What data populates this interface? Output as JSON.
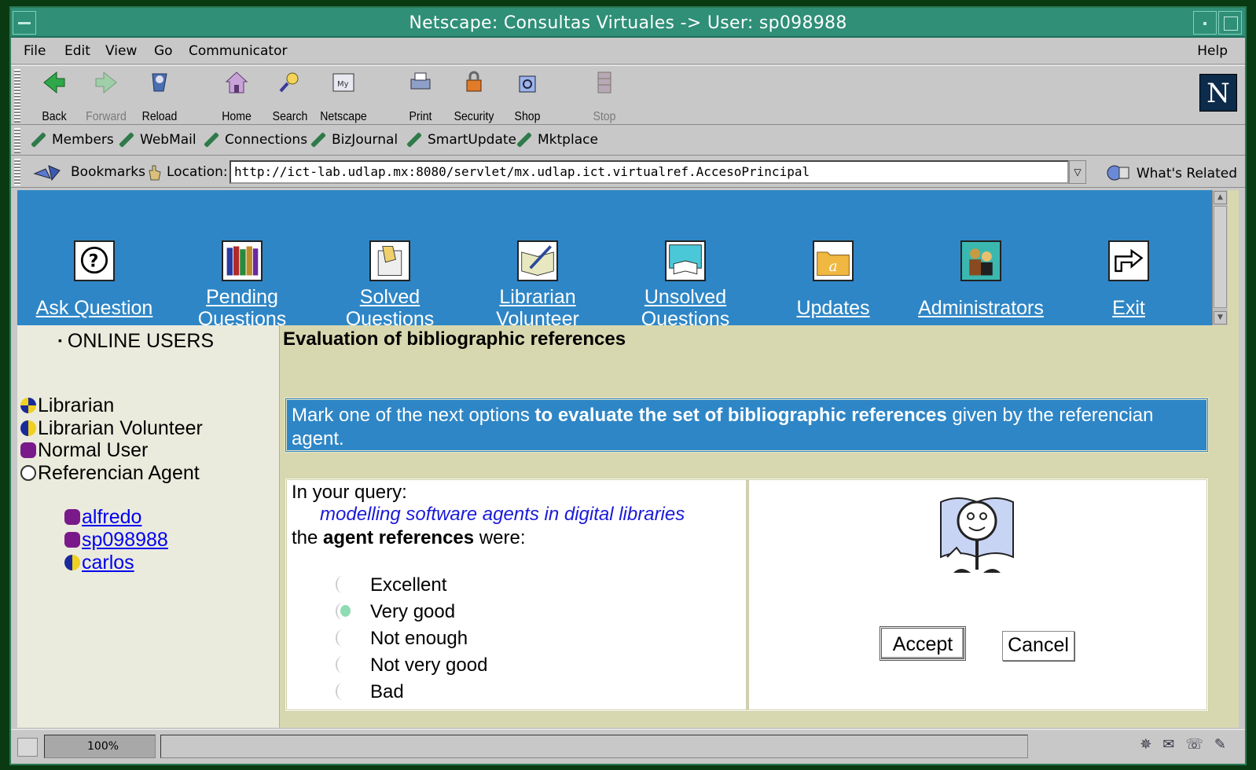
{
  "window": {
    "title": "Netscape: Consultas Virtuales -> User: sp098988"
  },
  "menu": {
    "file": "File",
    "edit": "Edit",
    "view": "View",
    "go": "Go",
    "communicator": "Communicator",
    "help": "Help"
  },
  "nav": {
    "back": "Back",
    "forward": "Forward",
    "reload": "Reload",
    "home": "Home",
    "search": "Search",
    "netscape": "Netscape",
    "print": "Print",
    "security": "Security",
    "shop": "Shop",
    "stop": "Stop"
  },
  "personal": {
    "members": "Members",
    "webmail": "WebMail",
    "connections": "Connections",
    "bizjournal": "BizJournal",
    "smartupdate": "SmartUpdate",
    "mktplace": "Mktplace"
  },
  "location": {
    "bookmarks": "Bookmarks",
    "label": "Location:",
    "url": "http://ict-lab.udlap.mx:8080/servlet/mx.udlap.ict.virtualref.AccesoPrincipal",
    "related": "What's Related"
  },
  "topnav": {
    "ask": "Ask Question",
    "pending_1": "Pending",
    "pending_2": "Questions",
    "solved_1": "Solved",
    "solved_2": "Questions",
    "librarian_1": "Librarian",
    "librarian_2": "Volunteer",
    "unsolved_1": "Unsolved",
    "unsolved_2": "Questions",
    "updates": "Updates",
    "admins": "Administrators",
    "exit": "Exit"
  },
  "sidebar": {
    "header": "ONLINE USERS",
    "legend": [
      "Librarian",
      "Librarian Volunteer",
      "Normal User",
      "Referencian Agent"
    ],
    "users": [
      "alfredo",
      "sp098988",
      "carlos"
    ]
  },
  "main": {
    "heading": "Evaluation of bibliographic references",
    "instr_1": "Mark one of the next options ",
    "instr_bold": "to evaluate the set of bibliographic references",
    "instr_2": " given by the referencian agent.",
    "q_intro": "In your query:",
    "query": "modelling software agents in digital libraries",
    "q_the": "the ",
    "q_bold": "agent references",
    "q_were": " were:",
    "options": [
      "Excellent",
      "Very good",
      "Not enough",
      "Not very good",
      "Bad"
    ],
    "selected": "Very good",
    "accept": "Accept",
    "cancel": "Cancel"
  },
  "status": {
    "zoom": "100%"
  },
  "colors": {
    "title_bar": "#2f8f77",
    "nav_blue": "#2e86c6",
    "page_bg": "#d8d8b0",
    "link": "#0000ee"
  }
}
